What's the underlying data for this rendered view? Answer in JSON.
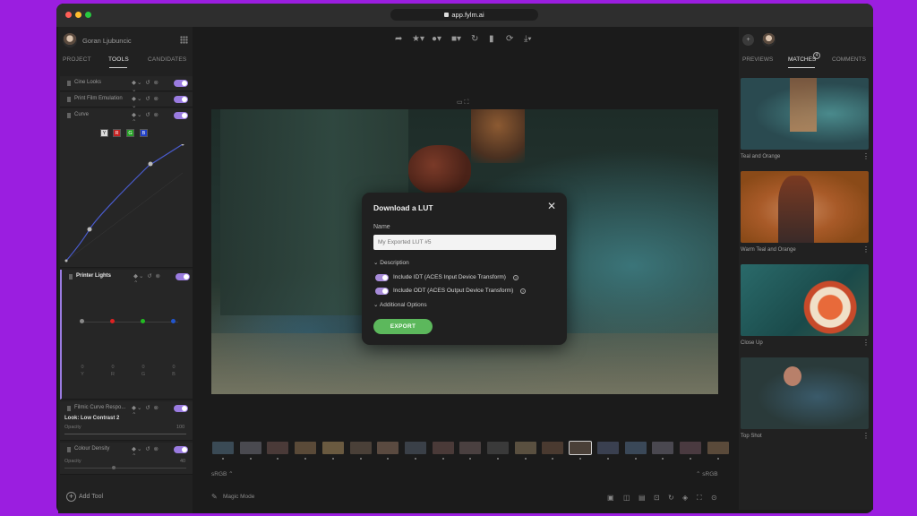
{
  "browser": {
    "url": "app.fylm.ai"
  },
  "left_panel": {
    "user_name": "Goran Ljubuncic",
    "tabs": [
      "PROJECT",
      "TOOLS",
      "CANDIDATES"
    ],
    "tools": [
      {
        "name": "Cine Looks"
      },
      {
        "name": "Print Film Emulation"
      },
      {
        "name": "Curve"
      },
      {
        "name": "Printer Lights"
      },
      {
        "name": "Filmic Curve Respo..."
      },
      {
        "name": "Colour Density"
      }
    ],
    "curve_channels": [
      "Y",
      "R",
      "G",
      "B"
    ],
    "printer_lights_values": [
      "0",
      "0",
      "0",
      "0"
    ],
    "printer_lights_channels": [
      "Y",
      "R",
      "G",
      "B"
    ],
    "filmic_look": "Look: Low Contrast 2",
    "filmic_opacity_label": "Opacity",
    "filmic_opacity_value": "100",
    "density_opacity_label": "Opacity",
    "density_opacity_value": "40",
    "add_tool": "Add Tool"
  },
  "center": {
    "color_space_left": "sRGB",
    "color_space_right": "sRGB",
    "magic_mode": "Magic Mode"
  },
  "modal": {
    "title": "Download a LUT",
    "name_label": "Name",
    "name_placeholder": "My Exported LUT #5",
    "description": "Description",
    "idt_label": "Include IDT (ACES Input Device Transform)",
    "odt_label": "Include ODT (ACES Output Device Transform)",
    "additional": "Additional Options",
    "export": "EXPORT"
  },
  "right_panel": {
    "tabs": [
      "PREVIEWS",
      "MATCHES",
      "COMMENTS"
    ],
    "matches_badge": "4",
    "items": [
      {
        "caption": "Teal and Orange"
      },
      {
        "caption": "Warm Teal and Orange"
      },
      {
        "caption": "Close Up"
      },
      {
        "caption": "Top Shot"
      }
    ]
  },
  "colors": {
    "accent": "#9a7be0",
    "export": "#5cb85c",
    "frame": "#9b1ee0"
  }
}
